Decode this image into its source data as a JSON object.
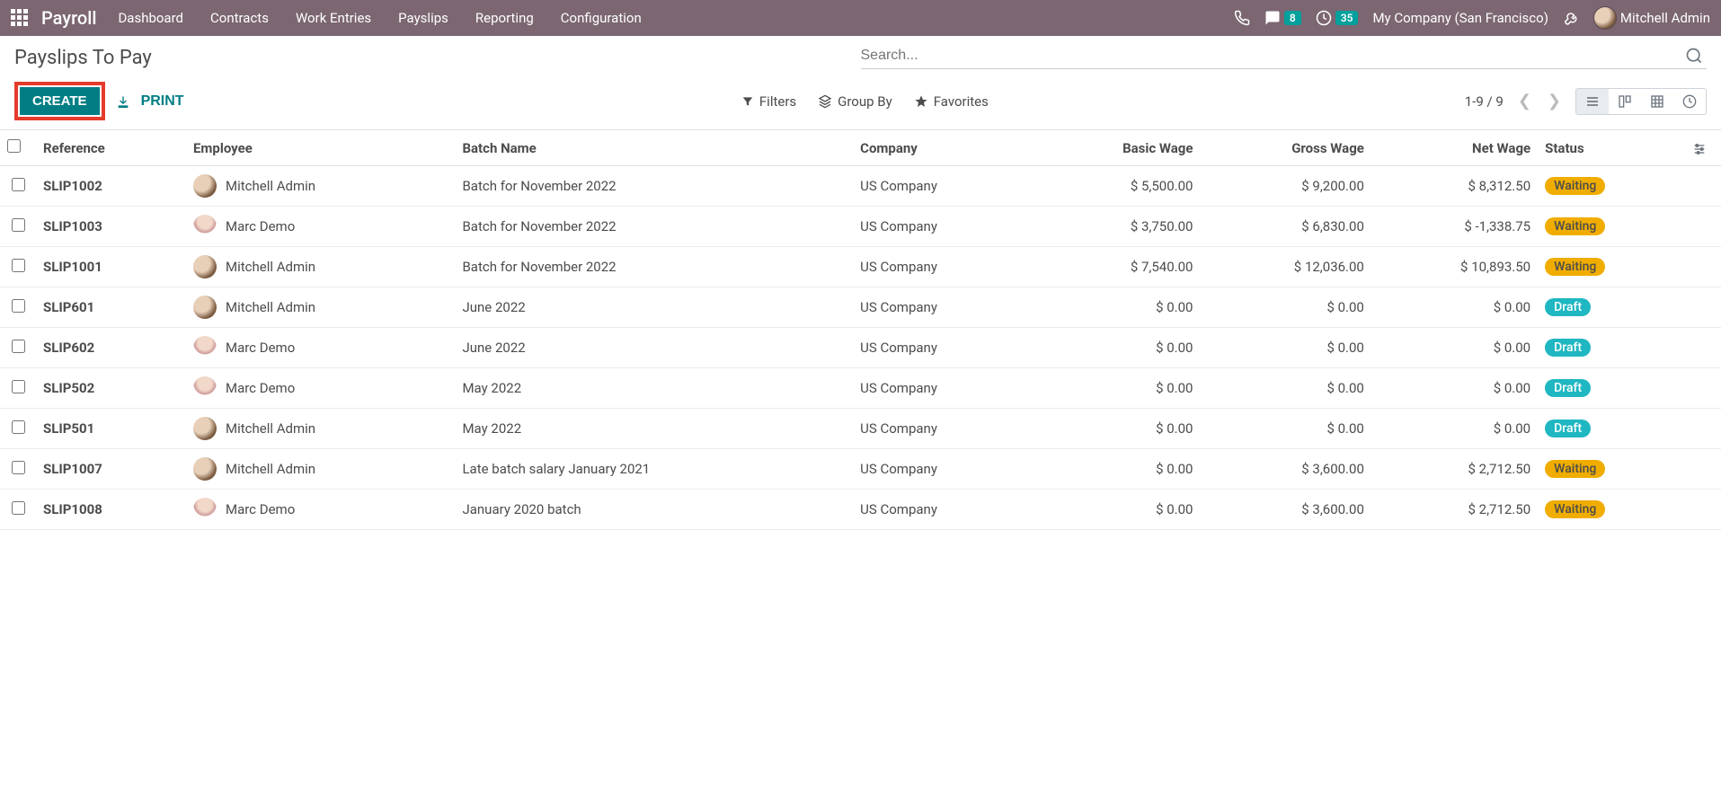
{
  "topnav": {
    "brand": "Payroll",
    "menu": [
      "Dashboard",
      "Contracts",
      "Work Entries",
      "Payslips",
      "Reporting",
      "Configuration"
    ],
    "messages_badge": "8",
    "clock_badge": "35",
    "company": "My Company (San Francisco)",
    "user": "Mitchell Admin"
  },
  "breadcrumb": "Payslips To Pay",
  "search": {
    "placeholder": "Search..."
  },
  "buttons": {
    "create": "CREATE",
    "print": "PRINT"
  },
  "filters": {
    "filters": "Filters",
    "groupby": "Group By",
    "favorites": "Favorites"
  },
  "pager": "1-9 / 9",
  "columns": {
    "reference": "Reference",
    "employee": "Employee",
    "batch": "Batch Name",
    "company": "Company",
    "basic": "Basic Wage",
    "gross": "Gross Wage",
    "net": "Net Wage",
    "status": "Status"
  },
  "rows": [
    {
      "ref": "SLIP1002",
      "emp": "Mitchell Admin",
      "av": "1",
      "batch": "Batch for November 2022",
      "company": "US Company",
      "basic": "$ 5,500.00",
      "gross": "$ 9,200.00",
      "net": "$ 8,312.50",
      "status": "Waiting",
      "stclass": "waiting"
    },
    {
      "ref": "SLIP1003",
      "emp": "Marc Demo",
      "av": "2",
      "batch": "Batch for November 2022",
      "company": "US Company",
      "basic": "$ 3,750.00",
      "gross": "$ 6,830.00",
      "net": "$ -1,338.75",
      "status": "Waiting",
      "stclass": "waiting"
    },
    {
      "ref": "SLIP1001",
      "emp": "Mitchell Admin",
      "av": "1",
      "batch": "Batch for November 2022",
      "company": "US Company",
      "basic": "$ 7,540.00",
      "gross": "$ 12,036.00",
      "net": "$ 10,893.50",
      "status": "Waiting",
      "stclass": "waiting"
    },
    {
      "ref": "SLIP601",
      "emp": "Mitchell Admin",
      "av": "1",
      "batch": "June 2022",
      "company": "US Company",
      "basic": "$ 0.00",
      "gross": "$ 0.00",
      "net": "$ 0.00",
      "status": "Draft",
      "stclass": "draft"
    },
    {
      "ref": "SLIP602",
      "emp": "Marc Demo",
      "av": "2",
      "batch": "June 2022",
      "company": "US Company",
      "basic": "$ 0.00",
      "gross": "$ 0.00",
      "net": "$ 0.00",
      "status": "Draft",
      "stclass": "draft"
    },
    {
      "ref": "SLIP502",
      "emp": "Marc Demo",
      "av": "2",
      "batch": "May 2022",
      "company": "US Company",
      "basic": "$ 0.00",
      "gross": "$ 0.00",
      "net": "$ 0.00",
      "status": "Draft",
      "stclass": "draft"
    },
    {
      "ref": "SLIP501",
      "emp": "Mitchell Admin",
      "av": "1",
      "batch": "May 2022",
      "company": "US Company",
      "basic": "$ 0.00",
      "gross": "$ 0.00",
      "net": "$ 0.00",
      "status": "Draft",
      "stclass": "draft"
    },
    {
      "ref": "SLIP1007",
      "emp": "Mitchell Admin",
      "av": "1",
      "batch": "Late batch salary January 2021",
      "company": "US Company",
      "basic": "$ 0.00",
      "gross": "$ 3,600.00",
      "net": "$ 2,712.50",
      "status": "Waiting",
      "stclass": "waiting"
    },
    {
      "ref": "SLIP1008",
      "emp": "Marc Demo",
      "av": "2",
      "batch": "January 2020 batch",
      "company": "US Company",
      "basic": "$ 0.00",
      "gross": "$ 3,600.00",
      "net": "$ 2,712.50",
      "status": "Waiting",
      "stclass": "waiting"
    }
  ]
}
